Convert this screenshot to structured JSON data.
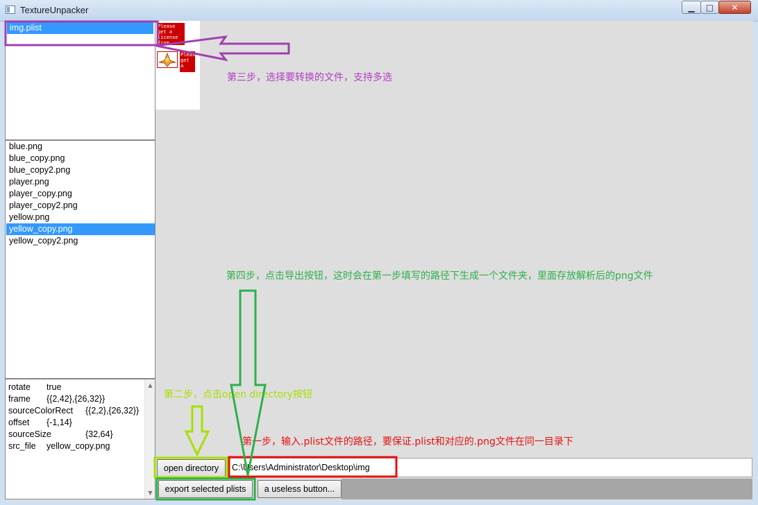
{
  "window": {
    "title": "TextureUnpacker",
    "minimize_glyph": "▁",
    "maximize_glyph": "□",
    "close_glyph": "✕"
  },
  "plist_list": {
    "items": [
      {
        "label": "img.plist",
        "selected": true
      }
    ]
  },
  "png_list": {
    "items": [
      {
        "label": "blue.png",
        "selected": false
      },
      {
        "label": "blue_copy.png",
        "selected": false
      },
      {
        "label": "blue_copy2.png",
        "selected": false
      },
      {
        "label": "player.png",
        "selected": false
      },
      {
        "label": "player_copy.png",
        "selected": false
      },
      {
        "label": "player_copy2.png",
        "selected": false
      },
      {
        "label": "yellow.png",
        "selected": false
      },
      {
        "label": "yellow_copy.png",
        "selected": true
      },
      {
        "label": "yellow_copy2.png",
        "selected": false
      }
    ]
  },
  "properties": [
    {
      "key": "rotate",
      "value": "true"
    },
    {
      "key": "frame",
      "value": "{{2,42},{26,32}}"
    },
    {
      "key": "sourceColorRect",
      "value": "{{2,2},{26,32}}"
    },
    {
      "key": "offset",
      "value": "{-1,14}"
    },
    {
      "key": "sourceSize",
      "value": "{32,64}"
    },
    {
      "key": "src_file",
      "value": "yellow_copy.png"
    }
  ],
  "texture_preview": {
    "tile_text_1": "Please get a license from",
    "tile_text_2": "Please get a"
  },
  "annotations": {
    "step3": "第三步，选择要转换的文件，支持多选",
    "step4": "第四步，点击导出按钮，这时会在第一步填写的路径下生成一个文件夹，里面存放解析后的png文件",
    "step2": "第二步，点击open directory按钮",
    "step1": "第一步，输入.plist文件的路径，要保证.plist和对应的.png文件在同一目录下"
  },
  "controls": {
    "open_directory_label": "open directory",
    "path_value": "C:\\Users\\Administrator\\Desktop\\img",
    "export_label": "export selected plists",
    "useless_label": "a useless button..."
  },
  "colors": {
    "selection": "#3399ff",
    "step1": "#e81010",
    "step2": "#a6e000",
    "step3": "#b040c0",
    "step4": "#2db04a"
  }
}
